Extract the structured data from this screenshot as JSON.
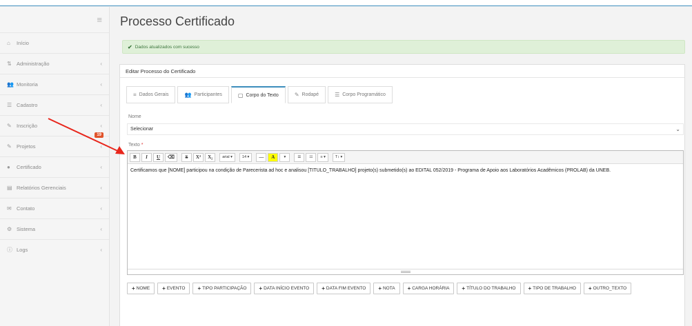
{
  "page_title": "Processo Certificado",
  "alert": {
    "message": "Dados atualizados com sucesso"
  },
  "sidebar": {
    "items": [
      {
        "label": "Início",
        "icon": "home-icon",
        "chevron": ""
      },
      {
        "label": "Administração",
        "icon": "sitemap-icon",
        "chevron": "‹"
      },
      {
        "label": "Monitoria",
        "icon": "users-icon",
        "chevron": "‹"
      },
      {
        "label": "Cadastro",
        "icon": "list-icon",
        "chevron": "‹"
      },
      {
        "label": "Inscrição",
        "icon": "edit-icon",
        "chevron": "‹"
      },
      {
        "label": "Projetos",
        "icon": "edit-icon",
        "chevron": "‹",
        "badge": "19"
      },
      {
        "label": "Certificado",
        "icon": "circle-icon",
        "chevron": "‹"
      },
      {
        "label": "Relatórios Gerenciais",
        "icon": "table-icon",
        "chevron": "‹"
      },
      {
        "label": "Contato",
        "icon": "envelope-icon",
        "chevron": "‹"
      },
      {
        "label": "Sistema",
        "icon": "cogs-icon",
        "chevron": "‹"
      },
      {
        "label": "Logs",
        "icon": "info-icon",
        "chevron": "‹"
      }
    ]
  },
  "panel": {
    "heading": "Editar Processo do Certificado",
    "tabs": [
      {
        "label": "Dados Gerais",
        "icon": "bars-icon"
      },
      {
        "label": "Participantes",
        "icon": "users-icon"
      },
      {
        "label": "Corpo do Texto",
        "icon": "file-icon"
      },
      {
        "label": "Rodapé",
        "icon": "pencil-icon"
      },
      {
        "label": "Corpo Programático",
        "icon": "list-icon"
      }
    ],
    "active_tab": "Corpo do Texto",
    "nome_label": "Nome",
    "nome_value": "Selecionar",
    "texto_label": "Texto",
    "required_mark": "*",
    "toolbar": {
      "bold": "B",
      "italic": "I",
      "underline": "U",
      "eraser": "⌫",
      "strike": "S",
      "superscript": "X²",
      "subscript": "X₂",
      "font_name": "arial ▾",
      "font_size": "14 ▾",
      "hr": "—",
      "color": "A",
      "color_caret": "▾",
      "ul": "☰",
      "ol": "☷",
      "align": "≡ ▾",
      "lineheight": "T↕ ▾"
    },
    "editor_text": "Certificamos que [NOME] participou na condição de Parecerista ad hoc e analisou [TITULO_TRABALHO] projeto(s) submetido(s) ao EDITAL 052/2019 - Programa de Apoio aos Laboratórios Acadêmicos (PROLAB) da UNEB.",
    "insert_buttons": [
      "NOME",
      "EVENTO",
      "TIPO PARTICIPAÇÃO",
      "DATA INÍCIO EVENTO",
      "DATA FIM EVENTO",
      "NOTA",
      "CARGA HORÁRIA",
      "TÍTULO DO TRABALHO",
      "TIPO DE TRABALHO",
      "OUTRO_TEXTO"
    ]
  },
  "colors": {
    "accent": "#3c8dbc",
    "alert_bg": "#dff0d8",
    "arrow": "#e8261c",
    "badge": "#e0532a"
  }
}
